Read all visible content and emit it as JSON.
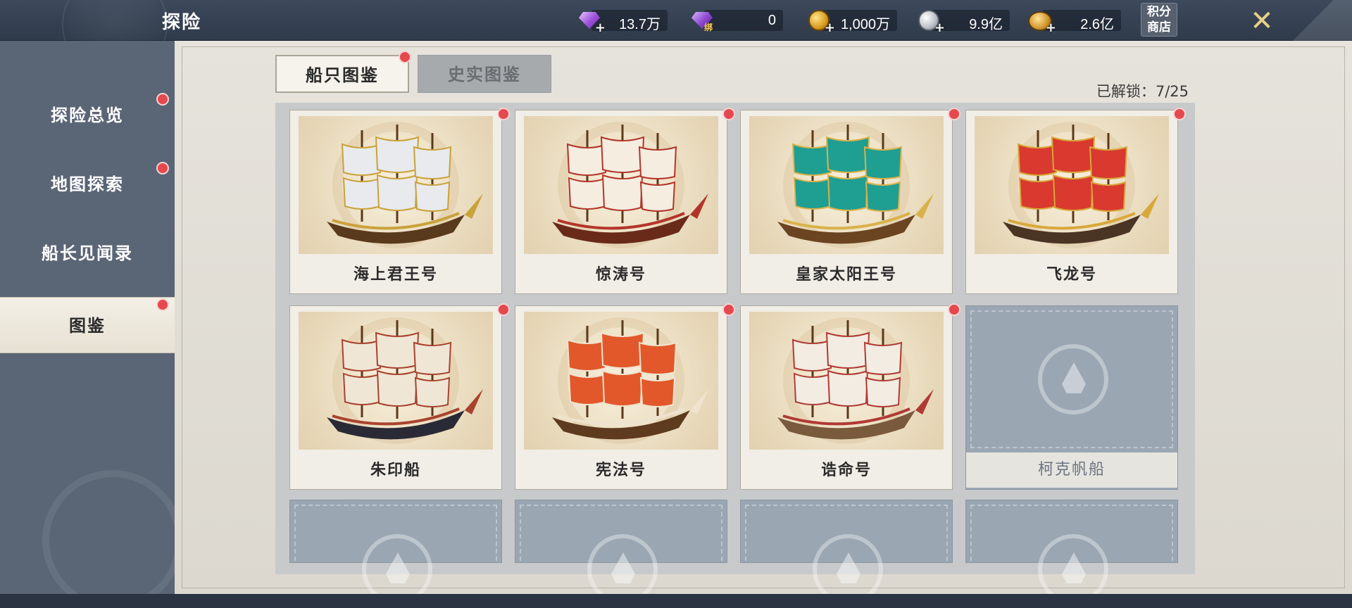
{
  "header": {
    "title": "探险",
    "currencies": [
      {
        "icon": "purple-diamond-icon",
        "value": "13.7万"
      },
      {
        "icon": "bound-purple-diamond-icon",
        "value": "0",
        "tag": "绑"
      },
      {
        "icon": "gold-coin-icon",
        "value": "1,000万"
      },
      {
        "icon": "silver-coin-icon",
        "value": "9.9亿"
      },
      {
        "icon": "gold-coin-stack-icon",
        "value": "2.6亿"
      }
    ],
    "shop_line1": "积分",
    "shop_line2": "商店",
    "close_icon": "close-icon"
  },
  "sidebar": {
    "items": [
      {
        "label": "探险总览",
        "badge": true
      },
      {
        "label": "地图探索",
        "badge": true
      },
      {
        "label": "船长见闻录",
        "badge": false
      },
      {
        "label": "图鉴",
        "badge": true,
        "active": true
      }
    ]
  },
  "tabs": [
    {
      "label": "船只图鉴",
      "active": true,
      "badge": true
    },
    {
      "label": "史实图鉴",
      "active": false,
      "badge": false
    }
  ],
  "unlock_text": "已解锁：7/25",
  "ships": [
    {
      "name": "海上君王号",
      "sail": "#e8eaee",
      "accent": "#c9a23a",
      "hull": "#5a3a1c",
      "badge": true
    },
    {
      "name": "惊涛号",
      "sail": "#f4ede0",
      "accent": "#b3352a",
      "hull": "#6a2a1a",
      "badge": true
    },
    {
      "name": "皇家太阳王号",
      "sail": "#1f9e92",
      "accent": "#d9b24a",
      "hull": "#6b4522",
      "badge": true
    },
    {
      "name": "飞龙号",
      "sail": "#d9392e",
      "accent": "#d8a83a",
      "hull": "#4a3424",
      "badge": true
    },
    {
      "name": "朱印船",
      "sail": "#efe6d6",
      "accent": "#a8432e",
      "hull": "#2a2a36",
      "badge": true
    },
    {
      "name": "宪法号",
      "sail": "#e2582a",
      "accent": "#efe3cf",
      "hull": "#5e3a1e",
      "badge": true
    },
    {
      "name": "诰命号",
      "sail": "#f2ece2",
      "accent": "#b03a34",
      "hull": "#7a5a3c",
      "badge": true
    }
  ],
  "locked_ships": [
    {
      "name": "柯克帆船"
    }
  ],
  "colors": {
    "badge": "#e5484d",
    "topbar": "#2f3a4a",
    "sidebar": "#5a6576",
    "panel": "#e6e3dc"
  }
}
